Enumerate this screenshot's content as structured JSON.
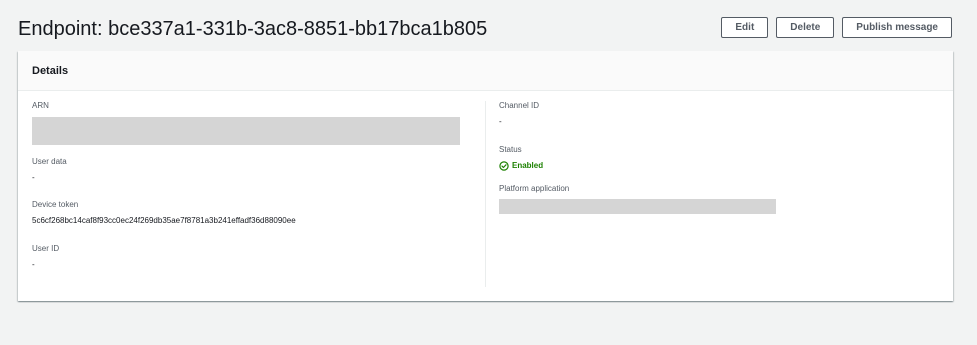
{
  "header": {
    "title": "Endpoint: bce337a1-331b-3ac8-8851-bb17bca1b805",
    "buttons": {
      "edit": "Edit",
      "delete": "Delete",
      "publish": "Publish message"
    }
  },
  "details": {
    "heading": "Details",
    "left": {
      "arn_label": "ARN",
      "user_data_label": "User data",
      "user_data_value": "-",
      "device_token_label": "Device token",
      "device_token_value": "5c6cf268bc14caf8f93cc0ec24f269db35ae7f8781a3b241effadf36d88090ee",
      "user_id_label": "User ID",
      "user_id_value": "-"
    },
    "right": {
      "channel_id_label": "Channel ID",
      "channel_id_value": "-",
      "status_label": "Status",
      "status_value": "Enabled",
      "platform_application_label": "Platform application"
    }
  },
  "colors": {
    "status_enabled": "#1d8102",
    "redacted": "#d5d5d5"
  }
}
